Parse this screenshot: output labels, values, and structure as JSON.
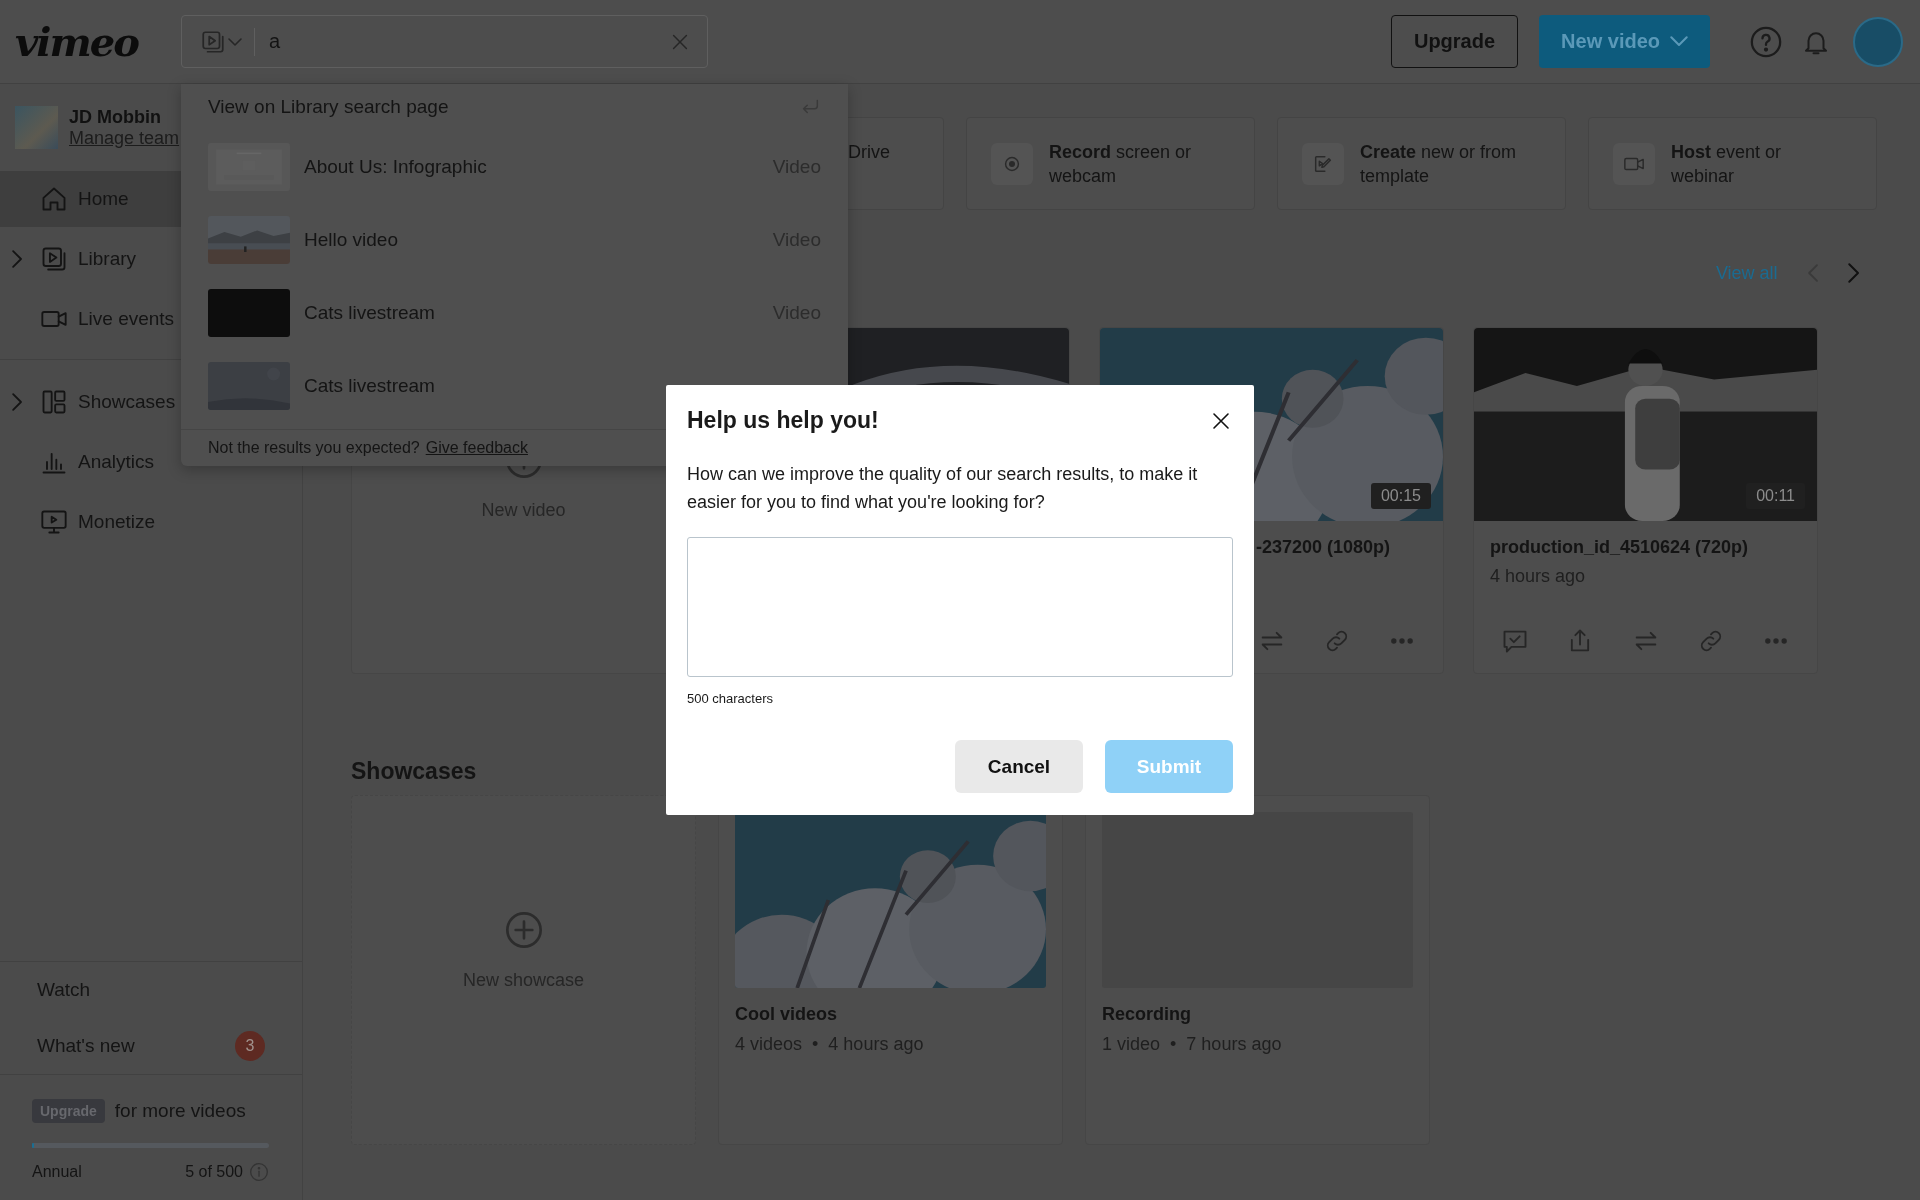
{
  "header": {
    "logo": "vimeo",
    "search": {
      "value": "a"
    },
    "buttons": [
      {
        "label": "Upgrade",
        "kind": "outline"
      },
      {
        "label": "New video",
        "kind": "primary"
      }
    ]
  },
  "sidebar": {
    "user": {
      "name": "JD Mobbin",
      "link": "Manage team"
    },
    "nav": [
      {
        "label": "Home",
        "selected": true,
        "expandable": false
      },
      {
        "label": "Library",
        "selected": false,
        "expandable": true
      },
      {
        "label": "Live events",
        "selected": false,
        "expandable": false
      },
      {
        "label": "Showcases",
        "selected": false,
        "expandable": true
      },
      {
        "label": "Analytics",
        "selected": false,
        "expandable": false
      },
      {
        "label": "Monetize",
        "selected": false,
        "expandable": false
      }
    ],
    "links": [
      {
        "label": "Watch"
      },
      {
        "label": "What's new",
        "badge": "3"
      }
    ],
    "plan": {
      "badge": "Upgrade",
      "text": "for more videos",
      "level": 0.01,
      "period": "Annual",
      "usage": "5 of 500"
    }
  },
  "quick_actions": [
    {
      "kind": "drive",
      "text": "Drive"
    },
    {
      "kind": "record",
      "text": "**Record** screen or webcam"
    },
    {
      "kind": "create",
      "text": "**Create** new or from template"
    },
    {
      "kind": "host",
      "text": "**Host** event or webinar"
    }
  ],
  "recent": {
    "view_all": "View all",
    "new_card": "New video",
    "videos": [
      {
        "kind": "video"
      },
      {
        "kind": "video",
        "duration": "00:15",
        "title": "-237200 (1080p)"
      },
      {
        "kind": "video",
        "duration": "00:11",
        "title": "production_id_4510624 (720p)",
        "time": "4 hours ago"
      }
    ]
  },
  "showcases": {
    "title": "Showcases",
    "new_card": "New showcase",
    "items": [
      {
        "name": "Cool videos",
        "meta": "4 videos  •  4 hours ago"
      },
      {
        "name": "Recording",
        "meta": "1 video  •  7 hours ago"
      }
    ]
  },
  "search_dropdown": {
    "view_all": "View on Library search page",
    "results": [
      {
        "title": "About Us: Infographic",
        "type": "Video"
      },
      {
        "title": "Hello video",
        "type": "Video"
      },
      {
        "title": "Cats livestream",
        "type": "Video"
      },
      {
        "title": "Cats livestream"
      }
    ],
    "footer": "Not the results you expected?",
    "feedback_link": "Give feedback"
  },
  "modal": {
    "title": "Help us help you!",
    "text": "How can we improve the quality of our search results, to make it easier for you to find what you're looking for?",
    "counter": "500 characters",
    "buttons": [
      {
        "label": "Cancel",
        "kind": "secondary",
        "disabled": false
      },
      {
        "label": "Submit",
        "kind": "primary",
        "disabled": true
      }
    ]
  }
}
